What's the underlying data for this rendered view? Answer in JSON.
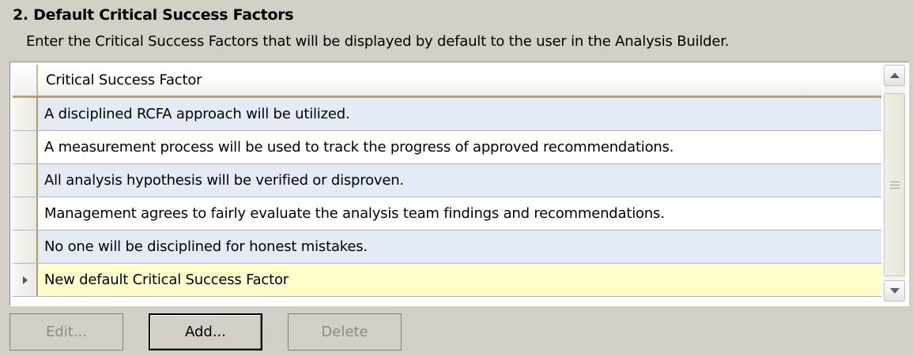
{
  "section": {
    "heading": "2. Default Critical Success Factors",
    "description": "Enter the Critical Success Factors that will be displayed by default to the user in the Analysis Builder."
  },
  "grid": {
    "column_header": "Critical Success Factor",
    "rows": [
      "A disciplined RCFA approach will be utilized.",
      "A measurement process will be used to track the progress of approved recommendations.",
      "All analysis hypothesis will be verified or disproven.",
      "Management agrees to fairly evaluate the analysis team findings and recommendations.",
      "No one will be disciplined for honest mistakes."
    ],
    "new_row": "New default Critical Success Factor"
  },
  "buttons": {
    "edit": "Edit...",
    "add": "Add...",
    "delete": "Delete"
  },
  "icons": {
    "scroll_up": "chevron-up-icon",
    "scroll_down": "chevron-down-icon",
    "row_pointer": "caret-right-icon",
    "thumb_grip": "grip-lines-icon"
  }
}
